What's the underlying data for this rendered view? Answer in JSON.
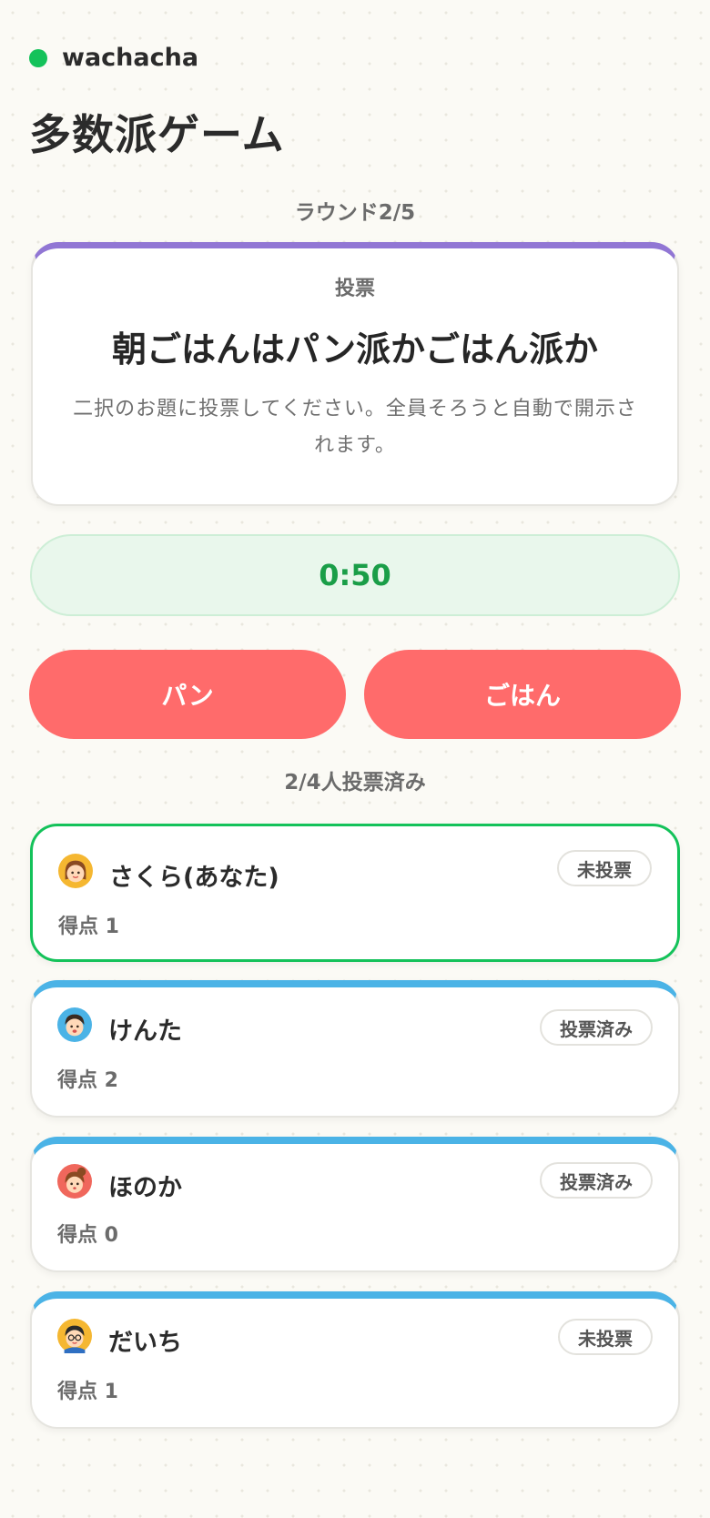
{
  "header": {
    "brand": "wachacha",
    "status_color": "#14c25a"
  },
  "page_title": "多数派ゲーム",
  "round": {
    "label": "ラウンド2/5",
    "current": 2,
    "total": 5
  },
  "topic_card": {
    "phase": "投票",
    "topic": "朝ごはんはパン派かごはん派か",
    "description": "二択のお題に投票してください。全員そろうと自動で開示されます。",
    "accent_color": "#9176d4"
  },
  "timer": {
    "value": "0:50"
  },
  "choices": [
    {
      "label": "パン"
    },
    {
      "label": "ごはん"
    }
  ],
  "choice_color": "#ff6b6b",
  "vote_count": "2/4人投票済み",
  "players": [
    {
      "name": "さくら(あなた)",
      "score": "得点 1",
      "status": "未投票",
      "is_me": true,
      "avatar_icon": "girl-avatar-icon"
    },
    {
      "name": "けんた",
      "score": "得点 2",
      "status": "投票済み",
      "is_me": false,
      "avatar_icon": "boy-avatar-icon"
    },
    {
      "name": "ほのか",
      "score": "得点 0",
      "status": "投票済み",
      "is_me": false,
      "avatar_icon": "girl-bun-avatar-icon"
    },
    {
      "name": "だいち",
      "score": "得点 1",
      "status": "未投票",
      "is_me": false,
      "avatar_icon": "glasses-boy-avatar-icon"
    }
  ],
  "colors": {
    "me_border": "#14c25a",
    "other_accent": "#4bb3e6",
    "timer_text": "#1a9e48"
  }
}
